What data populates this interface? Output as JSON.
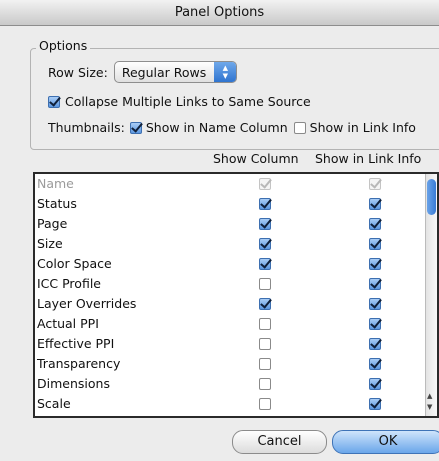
{
  "window": {
    "title": "Panel Options"
  },
  "options": {
    "legend": "Options",
    "row_size_label": "Row Size:",
    "row_size_value": "Regular Rows",
    "collapse_label": "Collapse Multiple Links to Same Source",
    "collapse_checked": true,
    "thumbnails_label": "Thumbnails:",
    "thumb_name_label": "Show in Name Column",
    "thumb_name_checked": true,
    "thumb_info_label": "Show in Link Info",
    "thumb_info_checked": false
  },
  "columns": {
    "show_column": "Show Column",
    "show_in_link_info": "Show in Link Info"
  },
  "rows": [
    {
      "label": "Name",
      "show_column": true,
      "show_info": true,
      "disabled": true
    },
    {
      "label": "Status",
      "show_column": true,
      "show_info": true
    },
    {
      "label": "Page",
      "show_column": true,
      "show_info": true
    },
    {
      "label": "Size",
      "show_column": true,
      "show_info": true
    },
    {
      "label": "Color Space",
      "show_column": true,
      "show_info": true
    },
    {
      "label": "ICC Profile",
      "show_column": false,
      "show_info": true
    },
    {
      "label": "Layer Overrides",
      "show_column": true,
      "show_info": true
    },
    {
      "label": "Actual PPI",
      "show_column": false,
      "show_info": true
    },
    {
      "label": "Effective PPI",
      "show_column": false,
      "show_info": true
    },
    {
      "label": "Transparency",
      "show_column": false,
      "show_info": true
    },
    {
      "label": "Dimensions",
      "show_column": false,
      "show_info": true
    },
    {
      "label": "Scale",
      "show_column": false,
      "show_info": true
    }
  ],
  "buttons": {
    "cancel": "Cancel",
    "ok": "OK"
  }
}
